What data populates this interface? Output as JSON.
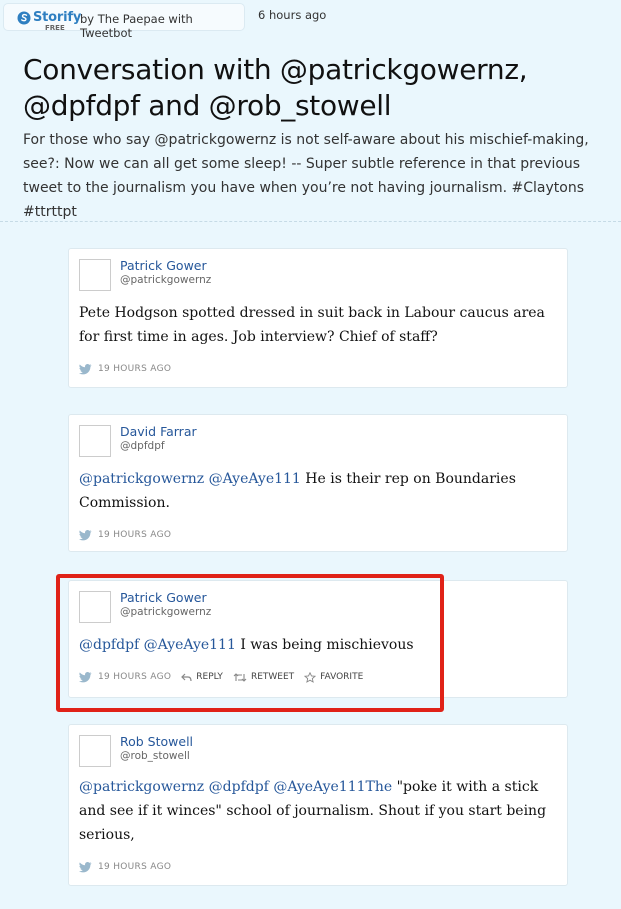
{
  "topbar": {
    "brand": "Storify",
    "brand_badge": "FREE",
    "byline": "by The Paepae with Tweetbot",
    "timestamp": "6 hours ago"
  },
  "header": {
    "title": "Conversation with @patrickgowernz, @dpfdpf and @rob_stowell",
    "description": "For those who say @patrickgowernz is not self-aware about his mischief-making, see?: Now we can all get some sleep! -- Super subtle reference in that previous tweet to the journalism you have when you’re not having journalism. #Claytons #ttrttpt"
  },
  "tweets": [
    {
      "name": "Patrick Gower",
      "handle": "@patrickgowernz",
      "text": "Pete Hodgson spotted dressed in suit back in Labour caucus area for first time in ages. Job interview? Chief of staff?",
      "time": "19 HOURS AGO"
    },
    {
      "name": "David Farrar",
      "handle": "@dpfdpf",
      "mentions": [
        "@patrickgowernz",
        "@AyeAye111"
      ],
      "text": " He is their rep on Boundaries Commission.",
      "time": "19 HOURS AGO"
    },
    {
      "name": "Patrick Gower",
      "handle": "@patrickgowernz",
      "mentions": [
        "@dpfdpf",
        "@AyeAye111"
      ],
      "text": " I was being mischievous",
      "time": "19 HOURS AGO",
      "actions": {
        "reply": "REPLY",
        "retweet": "RETWEET",
        "favorite": "FAVORITE"
      }
    },
    {
      "name": "Rob Stowell",
      "handle": "@rob_stowell",
      "mentions": [
        "@patrickgowernz",
        "@dpfdpf",
        "@AyeAye111The"
      ],
      "text": " \"poke it with a stick and see if it winces\" school of journalism. Shout if you start being serious,",
      "time": "19 HOURS AGO"
    }
  ],
  "colors": {
    "background": "#eaf7fd",
    "link": "#26579a",
    "brand": "#2f7fc1",
    "highlight": "#e02218"
  }
}
